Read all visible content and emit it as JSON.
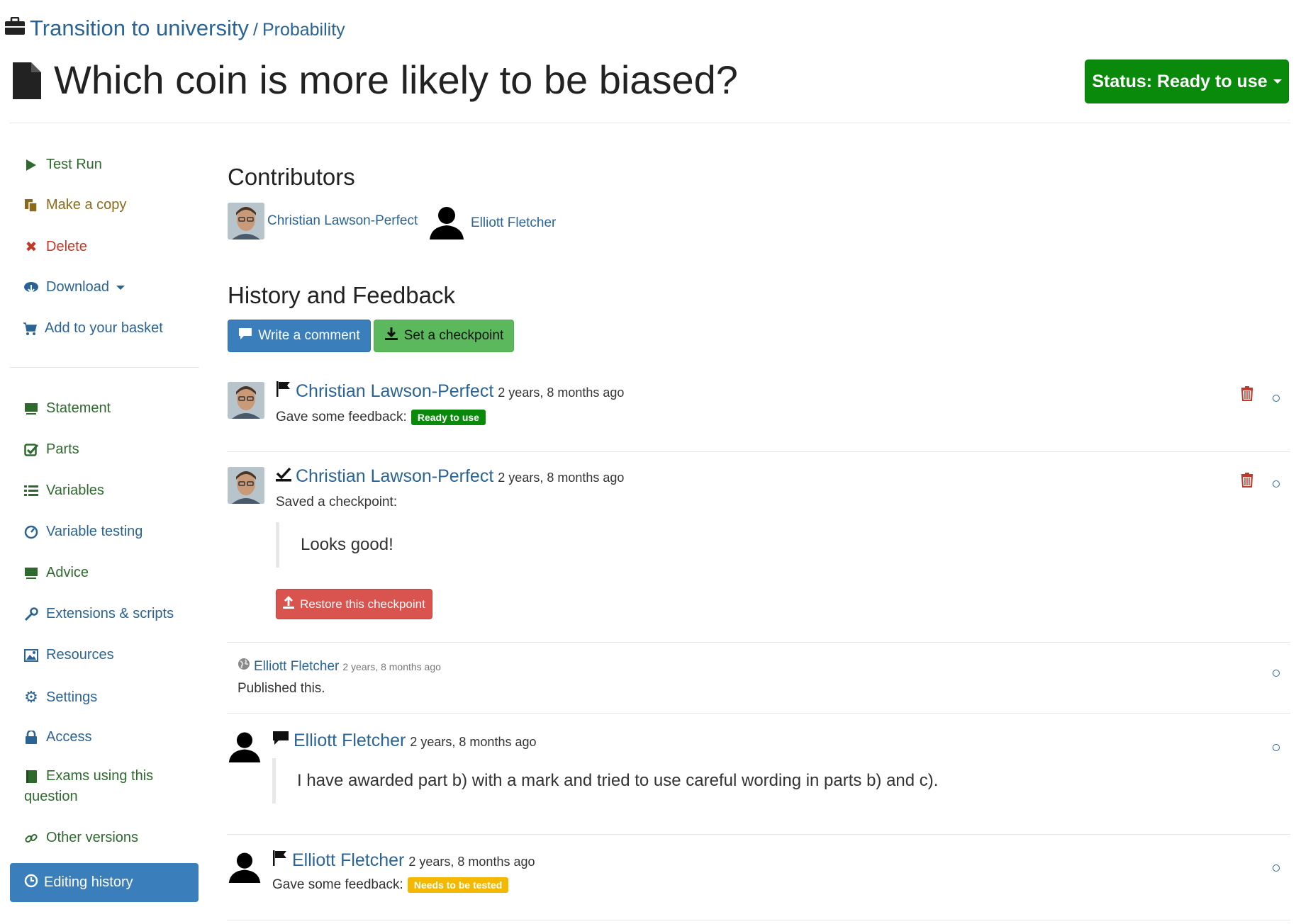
{
  "header": {
    "project": "Transition to university",
    "separator": "/",
    "folder": "Probability",
    "title": "Which coin is more likely to be biased?",
    "status_button": "Status: Ready to use"
  },
  "sidebar": {
    "actions": [
      {
        "label": "Test Run",
        "icon": "play-icon"
      },
      {
        "label": "Make a copy",
        "icon": "copy-icon"
      },
      {
        "label": "Delete",
        "icon": "delete-x-icon"
      },
      {
        "label": "Download",
        "icon": "cloud-download-icon"
      },
      {
        "label": "Add to your basket",
        "icon": "basket-icon"
      }
    ],
    "sections": [
      {
        "label": "Statement",
        "icon": "blackboard-icon"
      },
      {
        "label": "Parts",
        "icon": "check-square-icon"
      },
      {
        "label": "Variables",
        "icon": "list-icon"
      },
      {
        "label": "Variable testing",
        "icon": "dashboard-icon"
      },
      {
        "label": "Advice",
        "icon": "blackboard-icon"
      },
      {
        "label": "Extensions & scripts",
        "icon": "wrench-icon"
      },
      {
        "label": "Resources",
        "icon": "picture-icon"
      },
      {
        "label": "Settings",
        "icon": "gear-icon"
      },
      {
        "label": "Access",
        "icon": "lock-icon"
      },
      {
        "label": "Exams using this",
        "label2": "question",
        "icon": "book-icon"
      },
      {
        "label": "Other versions",
        "icon": "link-icon"
      },
      {
        "label": "Editing history",
        "icon": "clock-icon"
      }
    ]
  },
  "contributors": {
    "heading": "Contributors",
    "people": [
      "Christian Lawson-Perfect",
      "Elliott Fletcher"
    ]
  },
  "history": {
    "heading": "History and Feedback",
    "write_comment": "Write a comment",
    "set_checkpoint": "Set a checkpoint",
    "items": [
      {
        "author": "Christian Lawson-Perfect",
        "time": "2 years, 8 months ago",
        "text": "Gave some feedback:",
        "badge": "Ready to use",
        "badge_color": "#0a8a0a"
      },
      {
        "author": "Christian Lawson-Perfect",
        "time": "2 years, 8 months ago",
        "text": "Saved a checkpoint:",
        "quote": "Looks good!",
        "restore": "Restore this checkpoint"
      },
      {
        "author": "Elliott Fletcher",
        "time": "2 years, 8 months ago",
        "text": "Published this."
      },
      {
        "author": "Elliott Fletcher",
        "time": "2 years, 8 months ago",
        "quote": "I have awarded part b) with a mark and tried to use careful wording in parts b) and c)."
      },
      {
        "author": "Elliott Fletcher",
        "time": "2 years, 8 months ago",
        "text": "Gave some feedback:",
        "badge": "Needs to be tested",
        "badge_color": "#f5b800"
      }
    ]
  }
}
